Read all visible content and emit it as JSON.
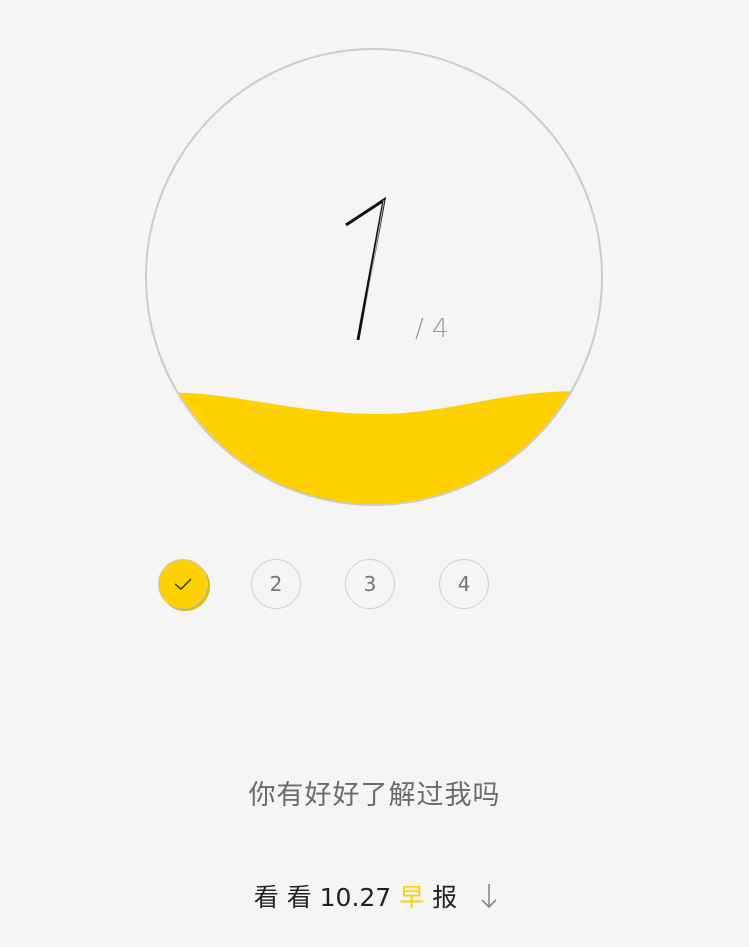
{
  "progress": {
    "current": "1",
    "total_label": "/ 4",
    "fill_fraction": 0.25,
    "fill_color": "#ffd100"
  },
  "steps": [
    {
      "label": "",
      "state": "done",
      "icon": "check-icon"
    },
    {
      "label": "2",
      "state": "pending"
    },
    {
      "label": "3",
      "state": "pending"
    },
    {
      "label": "4",
      "state": "pending"
    }
  ],
  "question_text": "你有好好了解过我吗",
  "footer": {
    "prefix": "看 看 10.27",
    "highlight": "早",
    "suffix": "报",
    "icon": "arrow-down-icon",
    "accent_color": "#ffd100"
  }
}
